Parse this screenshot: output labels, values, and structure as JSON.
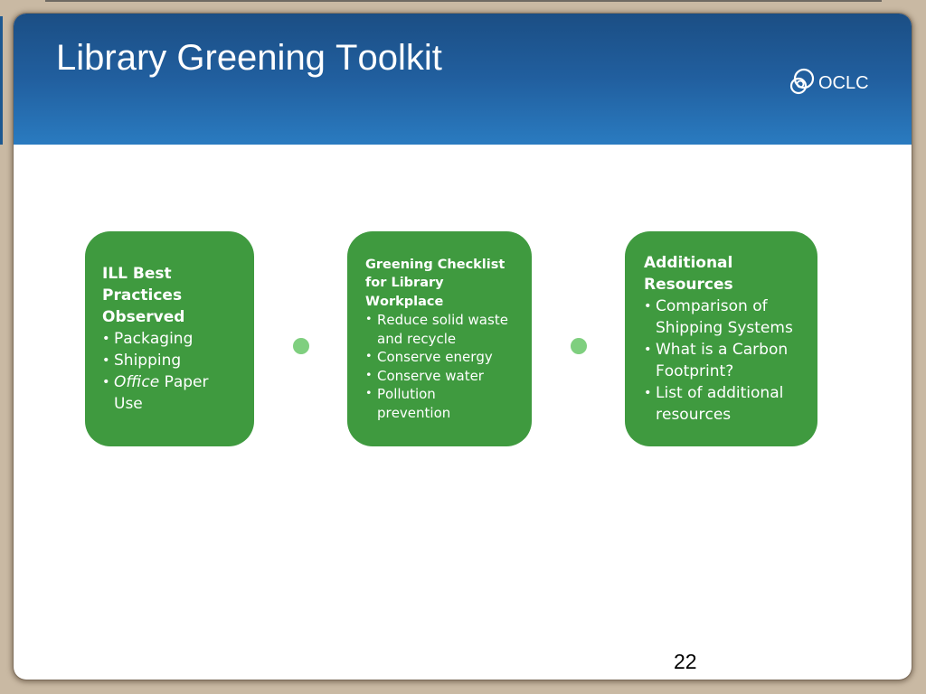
{
  "slide": {
    "title": "Library Greening Toolkit",
    "logo": {
      "text": "OCLC",
      "icon": "oclc-logo-icon"
    },
    "page_number": "22"
  },
  "diagram": {
    "boxes": [
      {
        "heading": "ILL Best Practices Observed",
        "bullets": [
          {
            "text": "Packaging"
          },
          {
            "text": "Shipping"
          },
          {
            "italic": "Office",
            "text": "Paper Use"
          }
        ]
      },
      {
        "heading": "Greening Checklist for Library Workplace",
        "bullets": [
          {
            "text": "Reduce solid waste and recycle"
          },
          {
            "text": "Conserve energy"
          },
          {
            "text": "Conserve water"
          },
          {
            "text": "Pollution prevention"
          }
        ]
      },
      {
        "heading": "Additional Resources",
        "bullets": [
          {
            "text": "Comparison of Shipping Systems"
          },
          {
            "text": "What is a Carbon Footprint?"
          },
          {
            "text": "List of additional resources"
          }
        ]
      }
    ]
  },
  "colors": {
    "header_top": "#1b4e84",
    "header_bottom": "#2a7bc0",
    "box_fill": "#3f9a3f",
    "box_text": "#ffffff",
    "connector": "#7fcf7f",
    "frame": "#c9b9a3",
    "page_number_text": "#000000"
  }
}
